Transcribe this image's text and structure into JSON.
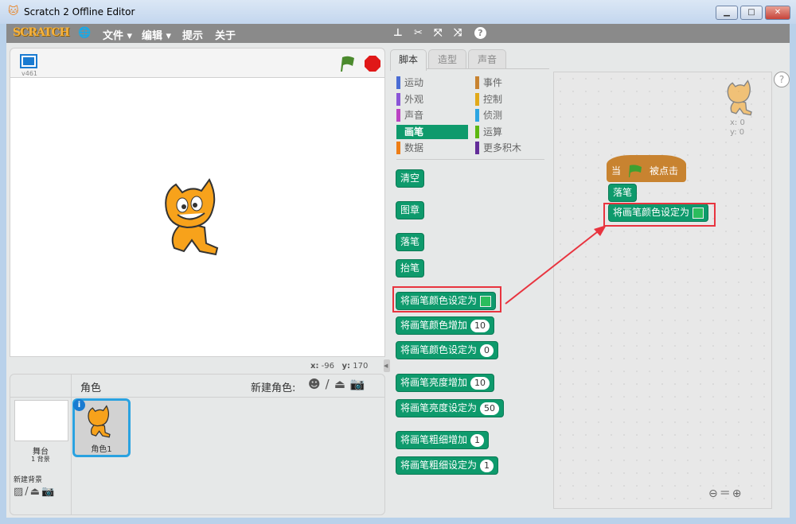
{
  "window": {
    "title": "Scratch 2 Offline Editor",
    "min": "▁",
    "max": "□",
    "close": "✕"
  },
  "menu": {
    "logo": "SCRATCH",
    "file": "文件 ▾",
    "edit": "编辑 ▾",
    "tips": "提示",
    "about": "关于"
  },
  "stage": {
    "version": "v461",
    "x_label": "x:",
    "x": "-96",
    "y_label": "y:",
    "y": "170"
  },
  "sprites": {
    "header": "角色",
    "new_sprite": "新建角色:",
    "stage_label": "舞台",
    "backdrops": "1 背景",
    "new_backdrop": "新建背景",
    "sprite1": "角色1"
  },
  "tabs": [
    "脚本",
    "造型",
    "声音"
  ],
  "categories": [
    {
      "label": "运动",
      "color": "#4a6cd4"
    },
    {
      "label": "事件",
      "color": "#c88330"
    },
    {
      "label": "外观",
      "color": "#8a55d7"
    },
    {
      "label": "控制",
      "color": "#e1a91a"
    },
    {
      "label": "声音",
      "color": "#bb42c3"
    },
    {
      "label": "侦测",
      "color": "#2ca5e2"
    },
    {
      "label": "画笔",
      "color": "#0e9a6c"
    },
    {
      "label": "运算",
      "color": "#5cb712"
    },
    {
      "label": "数据",
      "color": "#ee7d16"
    },
    {
      "label": "更多积木",
      "color": "#632d99"
    }
  ],
  "blocks": [
    {
      "label": "清空"
    },
    {
      "label": "图章"
    },
    {
      "label": "落笔"
    },
    {
      "label": "抬笔"
    },
    {
      "label": "将画笔颜色设定为",
      "color": true
    },
    {
      "label": "将画笔颜色增加",
      "value": "10"
    },
    {
      "label": "将画笔颜色设定为",
      "value": "0"
    },
    {
      "label": "将画笔亮度增加",
      "value": "10"
    },
    {
      "label": "将画笔亮度设定为",
      "value": "50"
    },
    {
      "label": "将画笔粗细增加",
      "value": "1"
    },
    {
      "label": "将画笔粗细设定为",
      "value": "1"
    }
  ],
  "script": {
    "hat_when": "当",
    "hat_clicked": "被点击",
    "pen_down": "落笔",
    "set_color": "将画笔颜色设定为",
    "sprite_x": "x: 0",
    "sprite_y": "y: 0",
    "help": "?"
  },
  "colors": {
    "pen": "#0e9a6c",
    "event": "#c88330",
    "highlight": "#e8343f"
  }
}
